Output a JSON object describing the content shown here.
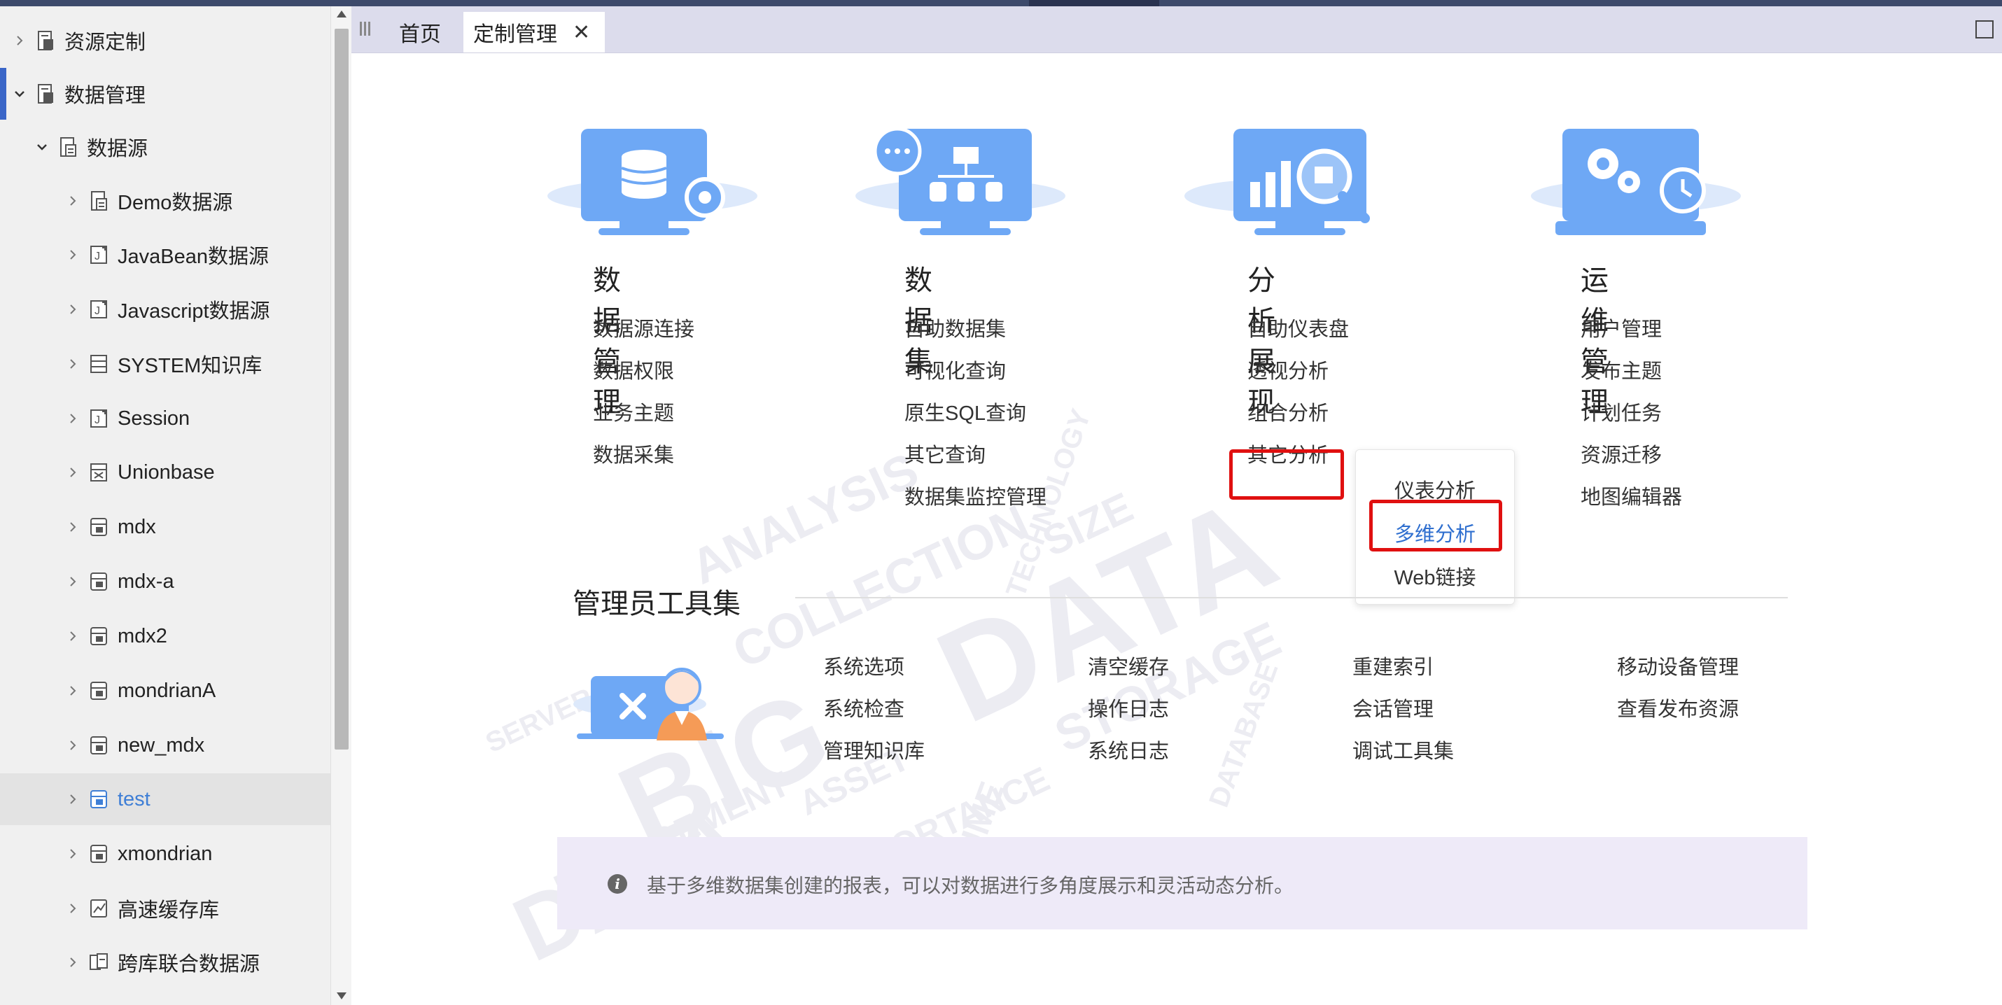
{
  "sidebar": {
    "items": [
      {
        "label": "资源定制",
        "level": 0,
        "expanded": false,
        "icon": "resource-icon"
      },
      {
        "label": "数据管理",
        "level": 0,
        "expanded": true,
        "icon": "data-manage-icon"
      },
      {
        "label": "数据源",
        "level": 1,
        "expanded": true,
        "icon": "datasource-folder-icon"
      },
      {
        "label": "Demo数据源",
        "level": 2,
        "expanded": false,
        "icon": "database-icon"
      },
      {
        "label": "JavaBean数据源",
        "level": 2,
        "expanded": false,
        "icon": "javabean-icon"
      },
      {
        "label": "Javascript数据源",
        "level": 2,
        "expanded": false,
        "icon": "javascript-icon"
      },
      {
        "label": "SYSTEM知识库",
        "level": 2,
        "expanded": false,
        "icon": "system-kb-icon"
      },
      {
        "label": "Session",
        "level": 2,
        "expanded": false,
        "icon": "session-icon"
      },
      {
        "label": "Unionbase",
        "level": 2,
        "expanded": false,
        "icon": "unionbase-icon"
      },
      {
        "label": "mdx",
        "level": 2,
        "expanded": false,
        "icon": "mdx-icon"
      },
      {
        "label": "mdx-a",
        "level": 2,
        "expanded": false,
        "icon": "mdx-icon"
      },
      {
        "label": "mdx2",
        "level": 2,
        "expanded": false,
        "icon": "mdx-icon"
      },
      {
        "label": "mondrianA",
        "level": 2,
        "expanded": false,
        "icon": "mdx-icon"
      },
      {
        "label": "new_mdx",
        "level": 2,
        "expanded": false,
        "icon": "mdx-icon"
      },
      {
        "label": "test",
        "level": 2,
        "expanded": false,
        "icon": "mdx-icon",
        "active": true
      },
      {
        "label": "xmondrian",
        "level": 2,
        "expanded": false,
        "icon": "mdx-icon"
      },
      {
        "label": "高速缓存库",
        "level": 2,
        "expanded": false,
        "icon": "cache-db-icon"
      },
      {
        "label": "跨库联合数据源",
        "level": 2,
        "expanded": false,
        "icon": "federated-db-icon"
      }
    ]
  },
  "tabs": {
    "home": "首页",
    "current": "定制管理"
  },
  "modules": [
    {
      "title": "数据管理",
      "links": [
        "数据源连接",
        "数据权限",
        "业务主题",
        "数据采集"
      ]
    },
    {
      "title": "数据集",
      "links": [
        "自助数据集",
        "可视化查询",
        "原生SQL查询",
        "其它查询",
        "数据集监控管理"
      ]
    },
    {
      "title": "分析展现",
      "links": [
        "自助仪表盘",
        "透视分析",
        "组合分析",
        "其它分析"
      ]
    },
    {
      "title": "运维管理",
      "links": [
        "用户管理",
        "发布主题",
        "计划任务",
        "资源迁移",
        "地图编辑器"
      ]
    }
  ],
  "popup": {
    "items": [
      "仪表分析",
      "多维分析",
      "Web链接"
    ],
    "selected_index": 1
  },
  "admin": {
    "title": "管理员工具集",
    "columns": [
      [
        "系统选项",
        "系统检查",
        "管理知识库"
      ],
      [
        "清空缓存",
        "操作日志",
        "系统日志"
      ],
      [
        "重建索引",
        "会话管理",
        "调试工具集"
      ],
      [
        "移动设备管理",
        "查看发布资源"
      ]
    ]
  },
  "info": {
    "text": "基于多维数据集创建的报表，可以对数据进行多角度展示和灵活动态分析。"
  },
  "colors": {
    "accent": "#3a66c8",
    "illustration_blue": "#6ea8f5",
    "highlight_red": "#e01010",
    "selected_text": "#2f6fcf",
    "info_bg": "#eeeaf8"
  }
}
